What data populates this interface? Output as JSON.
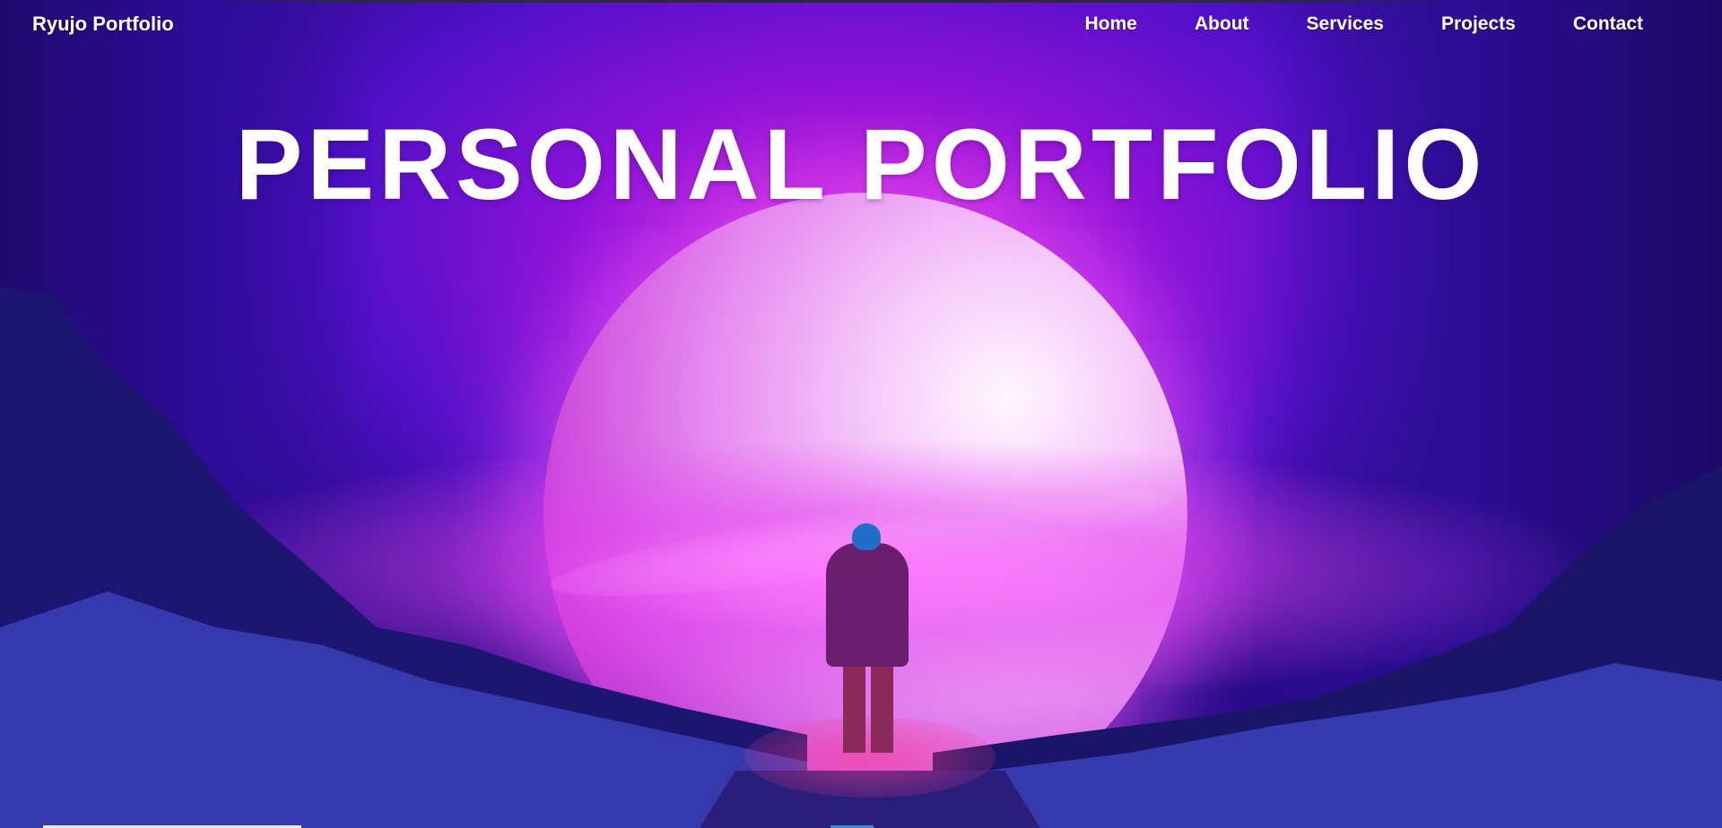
{
  "nav": {
    "brand": "Ryujo Portfolio",
    "links": [
      {
        "label": "Home"
      },
      {
        "label": "About"
      },
      {
        "label": "Services"
      },
      {
        "label": "Projects"
      },
      {
        "label": "Contact"
      }
    ]
  },
  "hero": {
    "headline": "PERSONAL PORTFOLIO"
  },
  "colors": {
    "accent_purple": "#8a12d8",
    "glow_magenta": "#e588f0",
    "text": "#ffffff"
  }
}
